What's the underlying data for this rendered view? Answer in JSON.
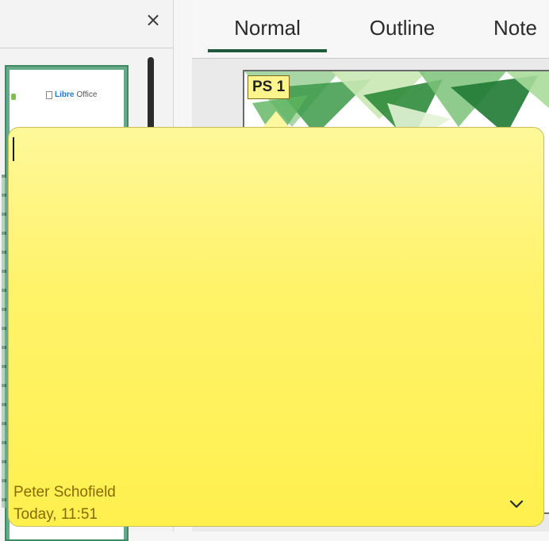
{
  "slide_pane": {
    "close_glyph": "×",
    "thumbnail_logo_bold": "Libre",
    "thumbnail_logo_rest": "Office"
  },
  "view_tabs": [
    {
      "label": "Normal",
      "active": true
    },
    {
      "label": "Outline",
      "active": false
    },
    {
      "label": "Note",
      "active": false
    }
  ],
  "comment": {
    "anchor_label": "PS 1",
    "body_text": "",
    "author": "Peter Schofield",
    "timestamp": "Today, 11:51",
    "menu_icon": "chevron-down-icon",
    "background_color": "#fff36a",
    "text_color": "#8a6a00"
  },
  "colors": {
    "active_tab_underline": "#1f5c3e",
    "slide_accent_green": "#2e8b3a"
  }
}
